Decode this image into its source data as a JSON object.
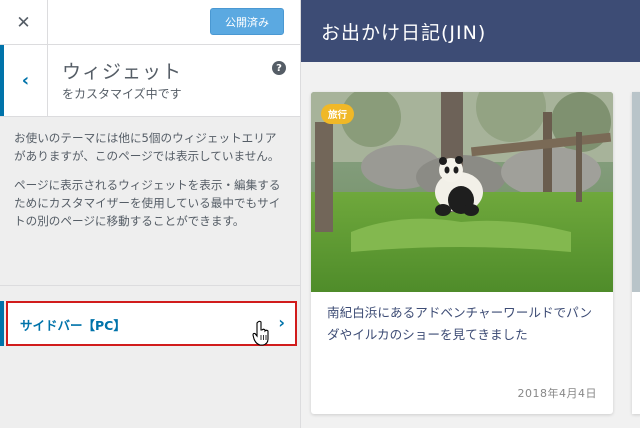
{
  "topbar": {
    "close_icon": "close-icon",
    "publish_label": "公開済み"
  },
  "section": {
    "back_icon": "chevron-left-icon",
    "title": "ウィジェット",
    "subtitle": "をカスタマイズ中です",
    "help_icon": "help-icon",
    "help_glyph": "?"
  },
  "notice": {
    "paragraph1": "お使いのテーマには他に5個のウィジェットエリアがありますが、このページでは表示していません。",
    "paragraph2": "ページに表示されるウィジェットを表示・編集するためにカスタマイザーを使用している最中でもサイトの別のページに移動することができます。"
  },
  "widget_areas": [
    {
      "label": "サイドバー【PC】",
      "icon": "chevron-right-icon"
    }
  ],
  "preview": {
    "site_title": "お出かけ日記(JIN)",
    "posts": [
      {
        "category": "旅行",
        "title": "南紀白浜にあるアドベンチャーワールドでパンダやイルカのショーを見てきました",
        "date": "2018年4月4日"
      }
    ]
  },
  "colors": {
    "accent": "#0073aa",
    "publish": "#5ba9e1",
    "highlight_border": "#d11c1c",
    "site_header": "#3d4c75",
    "tag": "#f0b827"
  }
}
